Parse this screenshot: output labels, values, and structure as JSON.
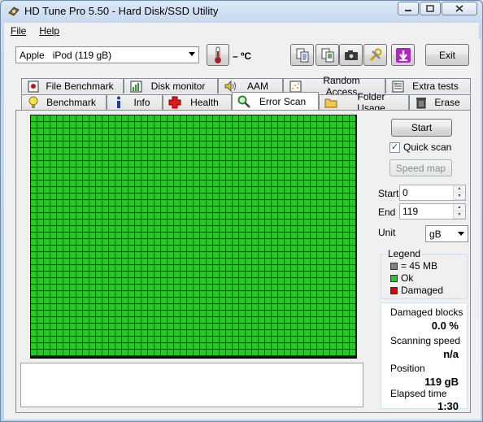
{
  "window": {
    "title": "HD Tune Pro 5.50 - Hard Disk/SSD Utility"
  },
  "menu": {
    "file": "File",
    "help": "Help"
  },
  "toolbar": {
    "drive": "Apple   iPod (119 gB)",
    "temperature": "– ºC",
    "exit_label": "Exit",
    "icons": [
      "copy-text-icon",
      "copy-info-icon",
      "screenshot-camera-icon",
      "options-tools-icon",
      "download-arrow-icon"
    ]
  },
  "tabs": {
    "row1": [
      {
        "label": "File Benchmark",
        "icon": "file-benchmark-icon"
      },
      {
        "label": "Disk monitor",
        "icon": "disk-monitor-icon"
      },
      {
        "label": "AAM",
        "icon": "speaker-icon"
      },
      {
        "label": "Random Access",
        "icon": "random-access-icon"
      },
      {
        "label": "Extra tests",
        "icon": "extra-tests-icon"
      }
    ],
    "row2": [
      {
        "label": "Benchmark",
        "icon": "benchmark-bulb-icon"
      },
      {
        "label": "Info",
        "icon": "info-icon"
      },
      {
        "label": "Health",
        "icon": "health-cross-icon"
      },
      {
        "label": "Error Scan",
        "icon": "magnifier-icon"
      },
      {
        "label": "Folder Usage",
        "icon": "folder-icon"
      },
      {
        "label": "Erase",
        "icon": "trash-icon"
      }
    ],
    "active": "Error Scan"
  },
  "scan": {
    "start_label": "Start",
    "quick_scan_label": "Quick scan",
    "quick_scan_checked": true,
    "speed_map_label": "Speed map",
    "start_field_label": "Start",
    "start_value": "0",
    "end_field_label": "End",
    "end_value": "119",
    "unit_label": "Unit",
    "unit_value": "gB",
    "grid_state": "all blocks ok",
    "block_color_ok": "#22cc22"
  },
  "legend": {
    "title": "Legend",
    "block_size": "= 45 MB",
    "ok": "Ok",
    "damaged": "Damaged",
    "colors": {
      "block": "#808080",
      "ok": "#22cc22",
      "damaged": "#dd0000"
    }
  },
  "stats": {
    "damaged_blocks_label": "Damaged blocks",
    "damaged_blocks_value": "0.0 %",
    "scanning_speed_label": "Scanning speed",
    "scanning_speed_value": "n/a",
    "position_label": "Position",
    "position_value": "119 gB",
    "elapsed_time_label": "Elapsed time",
    "elapsed_time_value": "1:30"
  }
}
